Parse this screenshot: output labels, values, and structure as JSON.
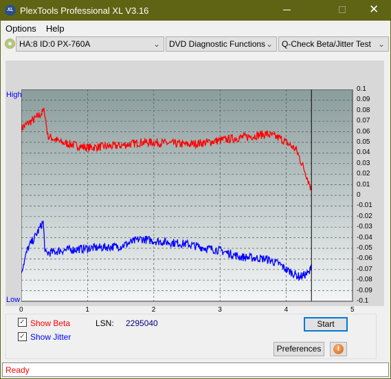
{
  "window": {
    "title": "PlexTools Professional XL V3.16",
    "logo": "XL",
    "controls": [
      "minimize-icon",
      "maximize-icon",
      "close-icon"
    ]
  },
  "menu": [
    "Options",
    "Help"
  ],
  "toolbar": {
    "drive": "HA:8 ID:0  PX-760A",
    "function": "DVD Diagnostic Functions",
    "test": "Q-Check Beta/Jitter Test"
  },
  "chart_data": {
    "type": "line",
    "left_labels": {
      "high": "High",
      "low": "Low"
    },
    "xlim": [
      0,
      5
    ],
    "ylim": [
      -0.1,
      0.1
    ],
    "x_ticks": [
      "0",
      "1",
      "2",
      "3",
      "4",
      "5"
    ],
    "y_ticks": [
      "0.1",
      "0.09",
      "0.08",
      "0.07",
      "0.06",
      "0.05",
      "0.04",
      "0.03",
      "0.02",
      "0.01",
      "0",
      "-0.01",
      "-0.02",
      "-0.03",
      "-0.04",
      "-0.05",
      "-0.06",
      "-0.07",
      "-0.08",
      "-0.09",
      "-0.1"
    ],
    "grid": true,
    "cursor_x": 4.38,
    "colors": {
      "beta": "#ff0000",
      "jitter": "#0000ff"
    },
    "series": [
      {
        "key": "beta",
        "x": [
          0,
          0.1,
          0.2,
          0.35,
          0.4,
          0.6,
          1.0,
          1.5,
          1.8,
          2.0,
          2.5,
          2.8,
          3.0,
          3.5,
          3.7,
          3.9,
          4.0,
          4.15,
          4.3,
          4.38
        ],
        "y": [
          0.063,
          0.068,
          0.072,
          0.08,
          0.056,
          0.05,
          0.045,
          0.047,
          0.05,
          0.05,
          0.048,
          0.05,
          0.052,
          0.056,
          0.058,
          0.054,
          0.05,
          0.043,
          0.02,
          0.005
        ]
      },
      {
        "key": "jitter",
        "x": [
          0,
          0.1,
          0.2,
          0.33,
          0.36,
          0.6,
          1.0,
          1.5,
          1.8,
          2.0,
          2.5,
          2.8,
          3.0,
          3.3,
          3.7,
          3.9,
          4.0,
          4.2,
          4.35,
          4.38
        ],
        "y": [
          -0.072,
          -0.05,
          -0.04,
          -0.025,
          -0.055,
          -0.052,
          -0.05,
          -0.048,
          -0.041,
          -0.043,
          -0.046,
          -0.05,
          -0.052,
          -0.058,
          -0.06,
          -0.065,
          -0.07,
          -0.077,
          -0.073,
          -0.065
        ]
      }
    ]
  },
  "options": {
    "show_beta": "Show Beta",
    "show_jitter": "Show Jitter",
    "beta_checked": true,
    "jitter_checked": true,
    "lsn_label": "LSN:",
    "lsn_value": "2295040"
  },
  "buttons": {
    "start": "Start",
    "preferences": "Preferences",
    "info": "i"
  },
  "status": "Ready"
}
